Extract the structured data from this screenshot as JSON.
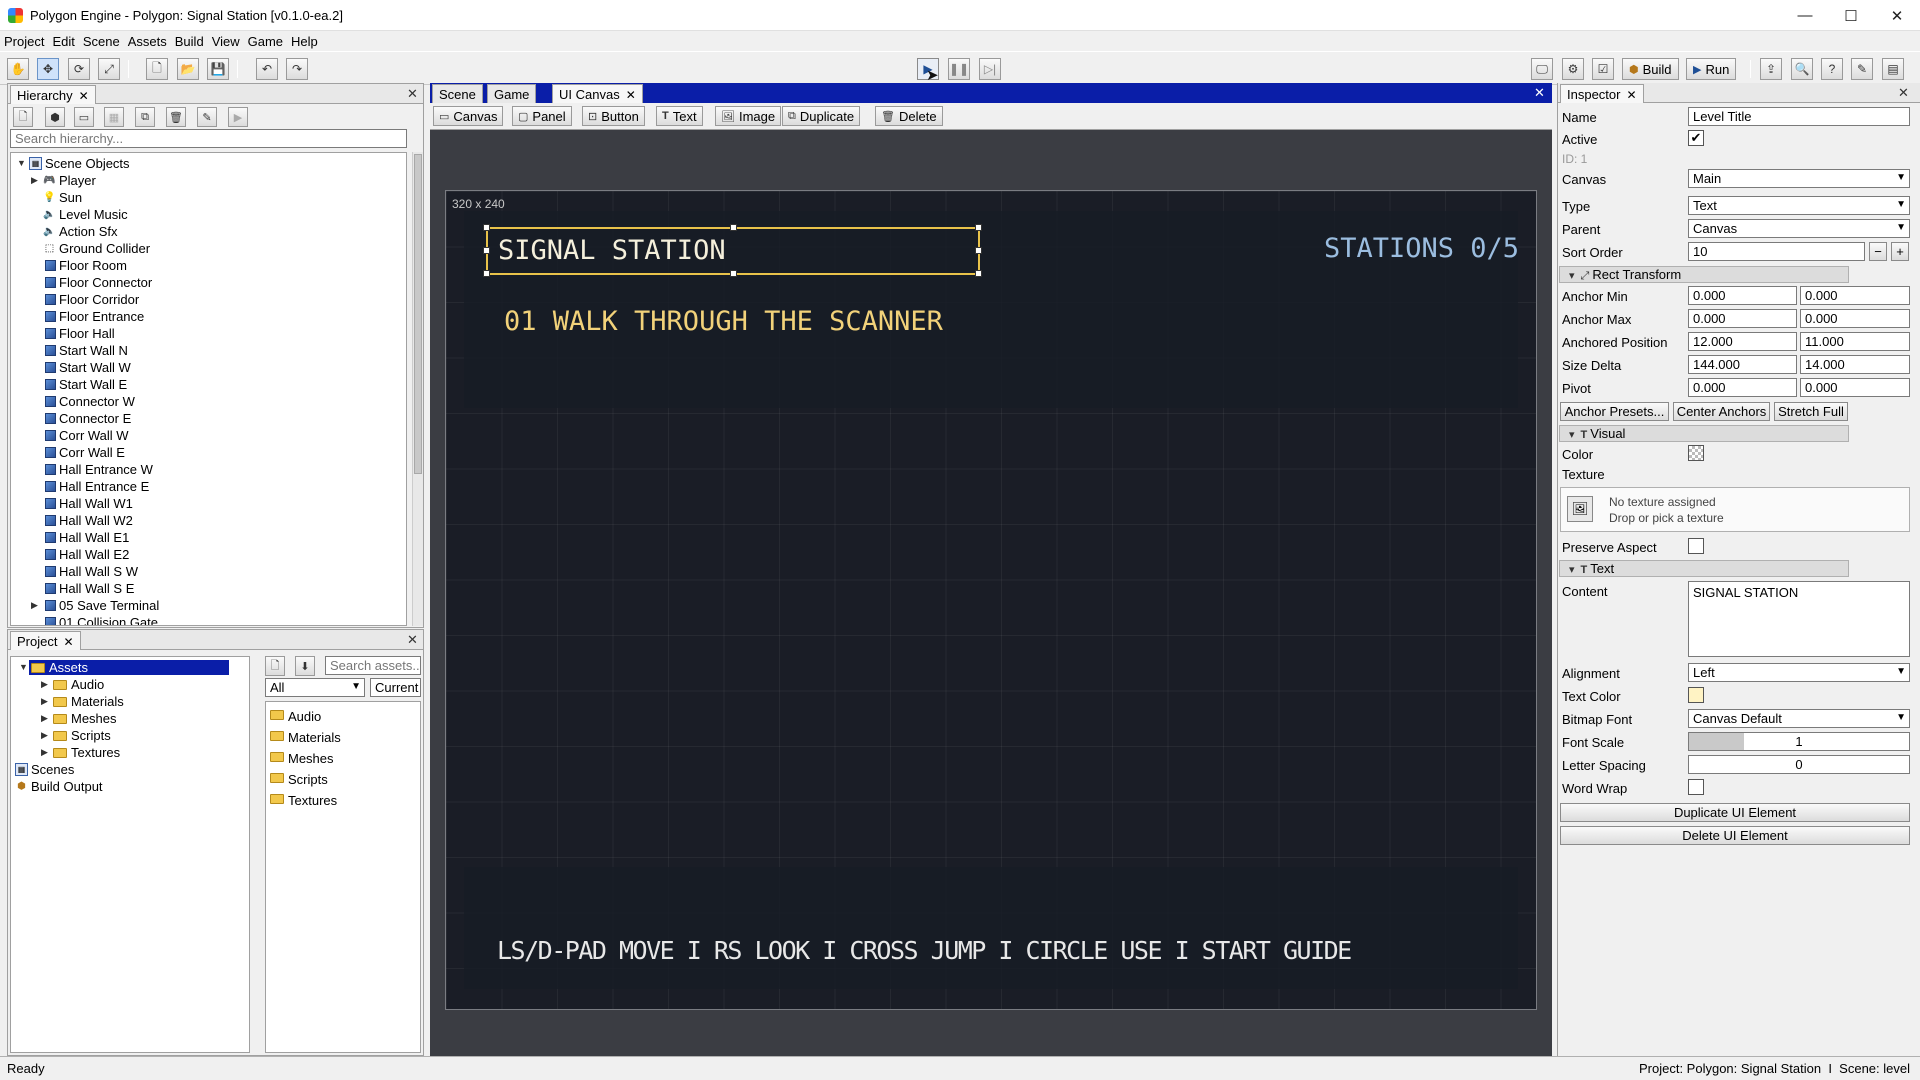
{
  "window": {
    "title": "Polygon Engine - Polygon: Signal Station [v0.1.0-ea.2]"
  },
  "menu": [
    "Project",
    "Edit",
    "Scene",
    "Assets",
    "Build",
    "View",
    "Game",
    "Help"
  ],
  "toolbar": {
    "build_label": "Build",
    "run_label": "Run"
  },
  "hierarchy": {
    "tab": "Hierarchy",
    "search_placeholder": "Search hierarchy...",
    "root": "Scene Objects",
    "items": [
      {
        "label": "Player",
        "icon": "gamepad-icon",
        "expandable": true
      },
      {
        "label": "Sun",
        "icon": "bulb-icon"
      },
      {
        "label": "Level Music",
        "icon": "speaker-icon"
      },
      {
        "label": "Action Sfx",
        "icon": "speaker-icon"
      },
      {
        "label": "Ground Collider",
        "icon": "collider-icon"
      },
      {
        "label": "Floor Room",
        "icon": "cube-icon"
      },
      {
        "label": "Floor Connector",
        "icon": "cube-icon"
      },
      {
        "label": "Floor Corridor",
        "icon": "cube-icon"
      },
      {
        "label": "Floor Entrance",
        "icon": "cube-icon"
      },
      {
        "label": "Floor Hall",
        "icon": "cube-icon"
      },
      {
        "label": "Start Wall N",
        "icon": "cube-icon"
      },
      {
        "label": "Start Wall W",
        "icon": "cube-icon"
      },
      {
        "label": "Start Wall E",
        "icon": "cube-icon"
      },
      {
        "label": "Connector W",
        "icon": "cube-icon"
      },
      {
        "label": "Connector E",
        "icon": "cube-icon"
      },
      {
        "label": "Corr Wall W",
        "icon": "cube-icon"
      },
      {
        "label": "Corr Wall E",
        "icon": "cube-icon"
      },
      {
        "label": "Hall Entrance W",
        "icon": "cube-icon"
      },
      {
        "label": "Hall Entrance E",
        "icon": "cube-icon"
      },
      {
        "label": "Hall Wall W1",
        "icon": "cube-icon"
      },
      {
        "label": "Hall Wall W2",
        "icon": "cube-icon"
      },
      {
        "label": "Hall Wall E1",
        "icon": "cube-icon"
      },
      {
        "label": "Hall Wall E2",
        "icon": "cube-icon"
      },
      {
        "label": "Hall Wall S W",
        "icon": "cube-icon"
      },
      {
        "label": "Hall Wall S E",
        "icon": "cube-icon"
      },
      {
        "label": "05 Save Terminal",
        "icon": "cube-icon",
        "expandable": true
      },
      {
        "label": "01 Collision Gate",
        "icon": "cube-icon"
      }
    ]
  },
  "project": {
    "tab": "Project",
    "tree_root": "Assets",
    "tree_children": [
      "Audio",
      "Materials",
      "Meshes",
      "Scripts",
      "Textures"
    ],
    "tree_other": [
      "Scenes",
      "Build Output"
    ],
    "search_placeholder": "Search assets...",
    "filter_value": "All",
    "scope_value": "Current Folder",
    "files": [
      "Audio",
      "Materials",
      "Meshes",
      "Scripts",
      "Textures"
    ]
  },
  "center": {
    "tabs": [
      "Scene",
      "Game",
      "UI Canvas"
    ],
    "ui_toolbar": [
      "Canvas",
      "Panel",
      "Button",
      "Text",
      "Image",
      "Duplicate",
      "Delete"
    ],
    "canvas_size": "320 x 240",
    "title_text": "SIGNAL STATION",
    "stations_text": "STATIONS 0/5",
    "objective_text": "01 WALK THROUGH THE SCANNER",
    "controls_text": "LS/D-PAD MOVE I RS LOOK I CROSS JUMP I CIRCLE USE I START GUIDE"
  },
  "inspector": {
    "tab": "Inspector",
    "name_label": "Name",
    "name_value": "Level Title",
    "active_label": "Active",
    "active_checked": true,
    "id_text": "ID: 1",
    "canvas_label": "Canvas",
    "canvas_value": "Main",
    "type_label": "Type",
    "type_value": "Text",
    "parent_label": "Parent",
    "parent_value": "Canvas",
    "sort_label": "Sort Order",
    "sort_value": "10",
    "rect_section": "Rect Transform",
    "anchor_min_label": "Anchor Min",
    "anchor_min": [
      "0.000",
      "0.000"
    ],
    "anchor_max_label": "Anchor Max",
    "anchor_max": [
      "0.000",
      "0.000"
    ],
    "anchored_pos_label": "Anchored Position",
    "anchored_pos": [
      "12.000",
      "11.000"
    ],
    "size_delta_label": "Size Delta",
    "size_delta": [
      "144.000",
      "14.000"
    ],
    "pivot_label": "Pivot",
    "pivot": [
      "0.000",
      "0.000"
    ],
    "anchor_presets": "Anchor Presets...",
    "center_anchors": "Center Anchors",
    "stretch_full": "Stretch Full",
    "visual_section": "Visual",
    "color_label": "Color",
    "texture_label": "Texture",
    "no_texture": "No texture assigned",
    "drop_texture": "Drop or pick a texture",
    "preserve_label": "Preserve Aspect",
    "text_section": "Text",
    "content_label": "Content",
    "content_value": "SIGNAL STATION",
    "alignment_label": "Alignment",
    "alignment_value": "Left",
    "text_color_label": "Text Color",
    "text_color": "#fff3c4",
    "font_label": "Bitmap Font",
    "font_value": "Canvas Default",
    "scale_label": "Font Scale",
    "scale_value": "1",
    "spacing_label": "Letter Spacing",
    "spacing_value": "0",
    "wrap_label": "Word Wrap",
    "duplicate_btn": "Duplicate UI Element",
    "delete_btn": "Delete UI Element"
  },
  "status": {
    "left": "Ready",
    "right": "Project: Polygon: Signal Station  I  Scene: level"
  },
  "colors": {
    "accent_blue": "#0a1ea8",
    "hud_yellow": "#f2d27a",
    "hud_blue": "#9bbde0",
    "hud_white": "#e8e8e8"
  }
}
